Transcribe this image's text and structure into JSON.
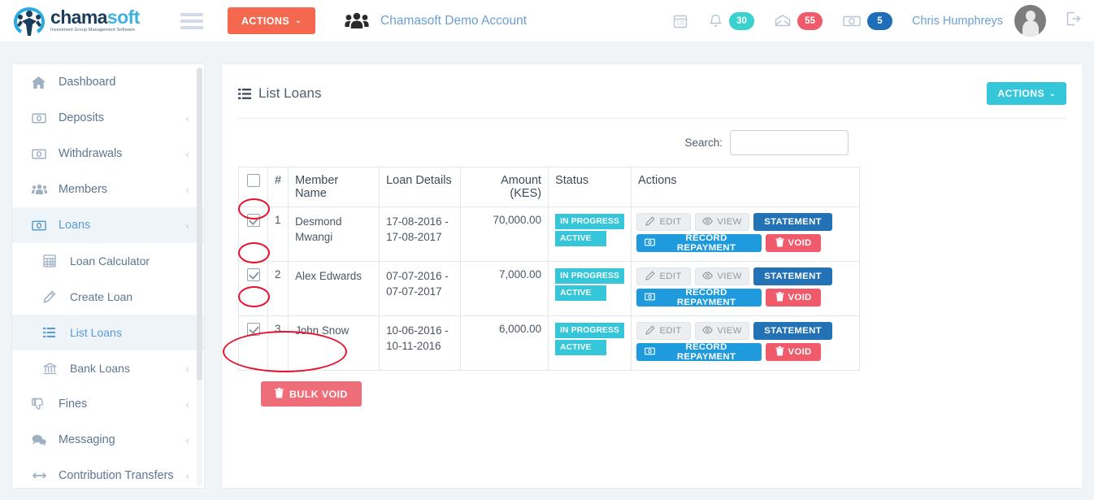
{
  "header": {
    "logo": {
      "word_a": "chama",
      "word_b": "soft",
      "tagline": "Investment Group Management Software",
      "icon": "chamasoft-logo-icon"
    },
    "menu_toggle_icon": "hamburger-icon",
    "actions_button": {
      "label": "ACTIONS",
      "caret": "⌄",
      "color": "#f4684f"
    },
    "group_icon": "users-group-icon",
    "account_name": "Chamasoft Demo Account",
    "indicators": [
      {
        "icon": "calendar-icon",
        "badge": null,
        "badge_color": null
      },
      {
        "icon": "bell-icon",
        "badge": "30",
        "badge_color": "#3ad2cf"
      },
      {
        "icon": "envelope-icon",
        "badge": "55",
        "badge_color": "#ef5b6b"
      },
      {
        "icon": "money-icon",
        "badge": "5",
        "badge_color": "#1e6fb8"
      }
    ],
    "user_name": "Chris Humphreys",
    "avatar_icon": "user-avatar",
    "logout_icon": "logout-icon"
  },
  "sidebar": {
    "items": [
      {
        "label": "Dashboard",
        "icon": "home-icon",
        "arrow": "",
        "active": false,
        "sub": false
      },
      {
        "label": "Deposits",
        "icon": "money-icon",
        "arrow": "‹",
        "active": false,
        "sub": false
      },
      {
        "label": "Withdrawals",
        "icon": "money-icon",
        "arrow": "‹",
        "active": false,
        "sub": false
      },
      {
        "label": "Members",
        "icon": "users-group-icon",
        "arrow": "‹",
        "active": false,
        "sub": false
      },
      {
        "label": "Loans",
        "icon": "money-icon",
        "arrow": "‹",
        "active": true,
        "sub": false
      },
      {
        "label": "Loan Calculator",
        "icon": "calculator-icon",
        "arrow": "",
        "active": false,
        "sub": true
      },
      {
        "label": "Create Loan",
        "icon": "pencil-icon",
        "arrow": "",
        "active": false,
        "sub": true
      },
      {
        "label": "List Loans",
        "icon": "list-icon",
        "arrow": "",
        "active": true,
        "sub": true
      },
      {
        "label": "Bank Loans",
        "icon": "bank-icon",
        "arrow": "‹",
        "active": false,
        "sub": true
      },
      {
        "label": "Fines",
        "icon": "thumbs-down-icon",
        "arrow": "‹",
        "active": false,
        "sub": false
      },
      {
        "label": "Messaging",
        "icon": "chat-bubbles-icon",
        "arrow": "‹",
        "active": false,
        "sub": false
      },
      {
        "label": "Contribution Transfers",
        "icon": "arrows-left-right-icon",
        "arrow": "‹",
        "active": false,
        "sub": false
      }
    ]
  },
  "main": {
    "title": "List Loans",
    "title_icon": "list-icon",
    "actions_button": {
      "label": "ACTIONS",
      "caret": "⌄",
      "color": "#35c7d9"
    },
    "search": {
      "label": "Search:",
      "value": "",
      "placeholder": ""
    },
    "table": {
      "columns": [
        "",
        "#",
        "Member Name",
        "Loan Details",
        "Amount (KES)",
        "Status",
        "Actions"
      ],
      "header_checkbox_checked": false,
      "rows": [
        {
          "checked": true,
          "num": "1",
          "member_name": "Desmond Mwangi",
          "loan_details": "17-08-2016 - 17-08-2017",
          "amount": "70,000.00",
          "status": [
            "IN PROGRESS",
            "ACTIVE"
          ],
          "actions": [
            {
              "label": "EDIT",
              "style": "light",
              "icon": "pencil-icon"
            },
            {
              "label": "VIEW",
              "style": "light",
              "icon": "eye-icon"
            },
            {
              "label": "STATEMENT",
              "style": "dark-blue",
              "icon": null
            },
            {
              "label": "RECORD REPAYMENT",
              "style": "blue",
              "icon": "money-icon"
            },
            {
              "label": "VOID",
              "style": "red",
              "icon": "trash-icon"
            }
          ]
        },
        {
          "checked": true,
          "num": "2",
          "member_name": "Alex Edwards",
          "loan_details": "07-07-2016 - 07-07-2017",
          "amount": "7,000.00",
          "status": [
            "IN PROGRESS",
            "ACTIVE"
          ],
          "actions": [
            {
              "label": "EDIT",
              "style": "light",
              "icon": "pencil-icon"
            },
            {
              "label": "VIEW",
              "style": "light",
              "icon": "eye-icon"
            },
            {
              "label": "STATEMENT",
              "style": "dark-blue",
              "icon": null
            },
            {
              "label": "RECORD REPAYMENT",
              "style": "blue",
              "icon": "money-icon"
            },
            {
              "label": "VOID",
              "style": "red",
              "icon": "trash-icon"
            }
          ]
        },
        {
          "checked": true,
          "num": "3",
          "member_name": "John Snow",
          "loan_details": "10-06-2016 - 10-11-2016",
          "amount": "6,000.00",
          "status": [
            "IN PROGRESS",
            "ACTIVE"
          ],
          "actions": [
            {
              "label": "EDIT",
              "style": "light",
              "icon": "pencil-icon"
            },
            {
              "label": "VIEW",
              "style": "light",
              "icon": "eye-icon"
            },
            {
              "label": "STATEMENT",
              "style": "dark-blue",
              "icon": null
            },
            {
              "label": "RECORD REPAYMENT",
              "style": "blue",
              "icon": "money-icon"
            },
            {
              "label": "VOID",
              "style": "red",
              "icon": "trash-icon"
            }
          ]
        }
      ]
    },
    "bulk_void": {
      "label": "BULK VOID",
      "icon": "trash-icon",
      "color": "#ef6d78"
    }
  },
  "annotations": [
    {
      "name": "row-1-checkbox-highlight"
    },
    {
      "name": "row-2-checkbox-highlight"
    },
    {
      "name": "row-3-checkbox-highlight"
    },
    {
      "name": "bulk-void-highlight"
    }
  ]
}
